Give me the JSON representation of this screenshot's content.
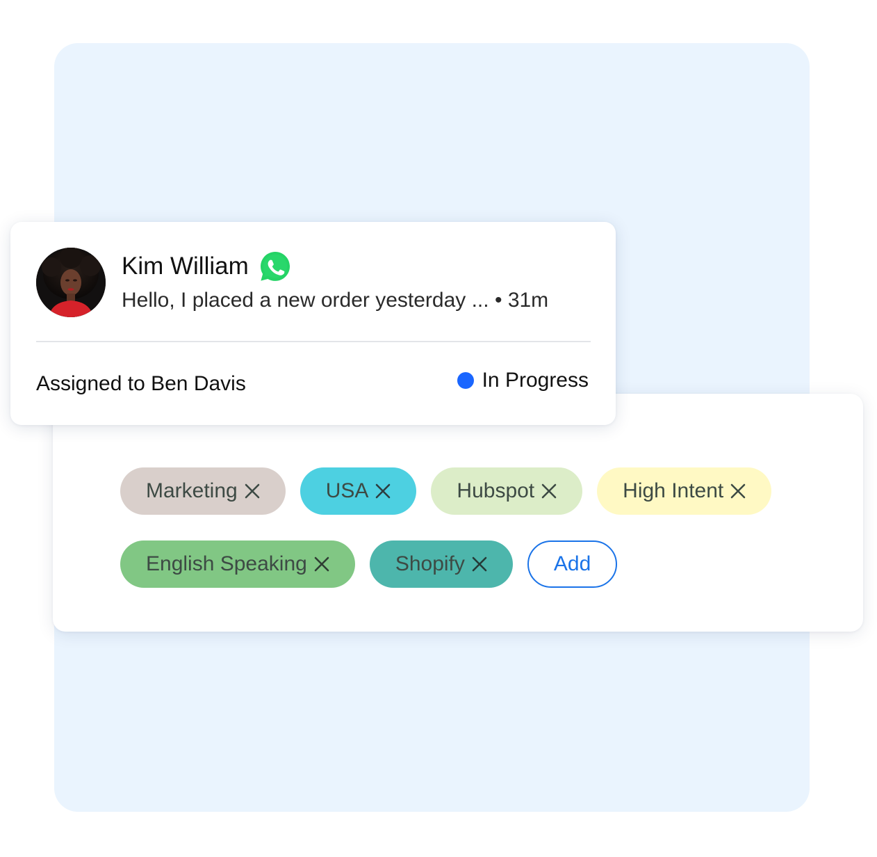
{
  "conversation": {
    "contact_name": "Kim William",
    "channel_icon": "whatsapp-icon",
    "message_preview": "Hello, I placed a new order yesterday ...",
    "separator": "•",
    "time_ago": "31m",
    "assigned_text": "Assigned to Ben Davis",
    "status_label": "In Progress",
    "status_color": "#1a66ff"
  },
  "tags": {
    "row1": [
      {
        "label": "Marketing",
        "bg": "#d9cfcb",
        "icon": "close-icon"
      },
      {
        "label": "USA",
        "bg": "#4dd0e1",
        "icon": "close-icon"
      },
      {
        "label": "Hubspot",
        "bg": "#dcedc8",
        "icon": "close-icon"
      },
      {
        "label": "High Intent",
        "bg": "#fff9c4",
        "icon": "close-icon"
      }
    ],
    "row2": [
      {
        "label": "English Speaking",
        "bg": "#81c784",
        "icon": "close-icon"
      },
      {
        "label": "Shopify",
        "bg": "#4db6ac",
        "icon": "close-icon"
      }
    ],
    "add_label": "Add"
  },
  "colors": {
    "accent": "#1a73e8",
    "whatsapp": "#25d366",
    "panel_bg": "#eaf4fe"
  }
}
